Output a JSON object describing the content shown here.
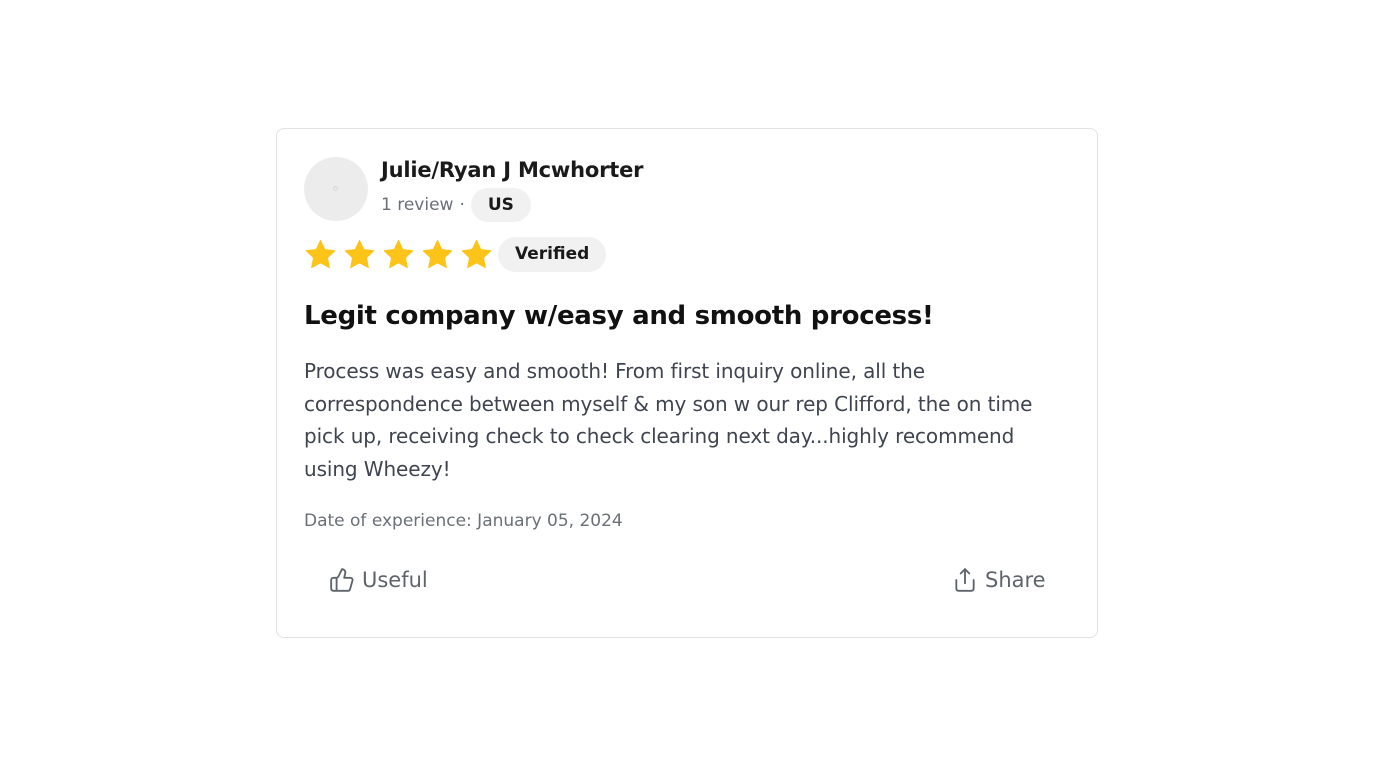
{
  "review": {
    "reviewer_name": "Julie/Ryan J Mcwhorter",
    "review_count": "1 review",
    "separator": "·",
    "country": "US",
    "rating": 5,
    "rating_max": 5,
    "star_color": "#fcc419",
    "verified_label": "Verified",
    "title": "Legit company w/easy and smooth process!",
    "body": "Process was easy and smooth! From first inquiry online, all the correspondence between myself & my son w our rep Clifford, the on time pick up, receiving check to check clearing next day...highly recommend using Wheezy!",
    "date_of_experience": "Date of experience: January 05, 2024"
  },
  "actions": {
    "useful_label": "Useful",
    "useful_icon": "thumbs-up-icon",
    "share_label": "Share",
    "share_icon": "share-icon"
  }
}
